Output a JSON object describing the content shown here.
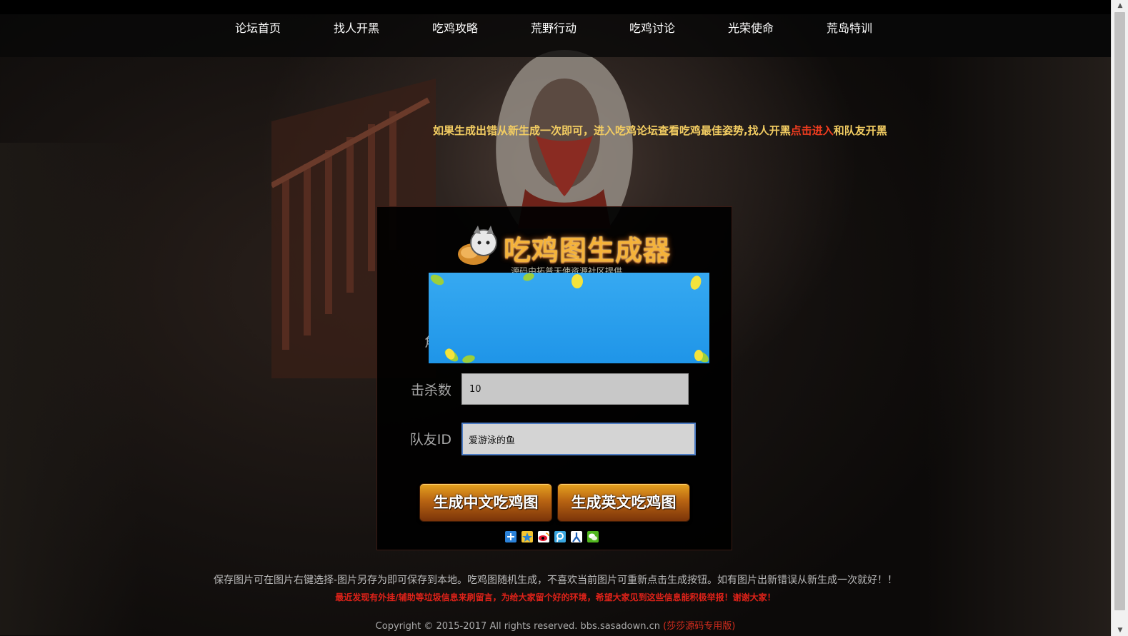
{
  "nav": {
    "items": [
      {
        "label": "论坛首页"
      },
      {
        "label": "找人开黑"
      },
      {
        "label": "吃鸡攻略"
      },
      {
        "label": "荒野行动"
      },
      {
        "label": "吃鸡讨论"
      },
      {
        "label": "光荣使命"
      },
      {
        "label": "荒岛特训"
      }
    ]
  },
  "marquee": {
    "text_before": "如果生成出错从新生成一次即可，进入吃鸡论坛查看吃鸡最佳姿势,找人开黑",
    "link": "点击进入",
    "text_after": "和队友开黑"
  },
  "generator": {
    "logo_text": "吃鸡图生成器",
    "logo_subtitle": "源码由拓普天使资源社区提供",
    "fields": {
      "role_label_partial": "角色",
      "kills_label": "击杀数",
      "kills_value": "10",
      "teammate_label": "队友ID",
      "teammate_value": "爱游泳的鱼"
    },
    "buttons": {
      "cn": "生成中文吃鸡图",
      "en": "生成英文吃鸡图"
    }
  },
  "share_icons": [
    "share-more-icon",
    "qzone-icon",
    "weibo-icon",
    "tencent-weibo-icon",
    "renren-icon",
    "wechat-icon"
  ],
  "footer": {
    "main": "保存图片可在图片右键选择-图片另存为即可保存到本地。吃鸡图随机生成，不喜欢当前图片可重新点击生成按钮。如有图片出新错误从新生成一次就好！！",
    "warning": "最近发现有外挂/辅助等垃圾信息来刷留言，为给大家留个好的环境，希望大家见到这些信息能积极举报！谢谢大家！",
    "copyright": "Copyright © 2015-2017 All rights reserved. bbs.sasadown.cn",
    "copyright_red": "(莎莎源码专用版)"
  },
  "colors": {
    "marquee_text": "#f3cd62",
    "marquee_link": "#ee3c1f",
    "warning": "#e02219",
    "button_gold": "#e6a21f",
    "ad_blue": "#2a9ef0"
  }
}
